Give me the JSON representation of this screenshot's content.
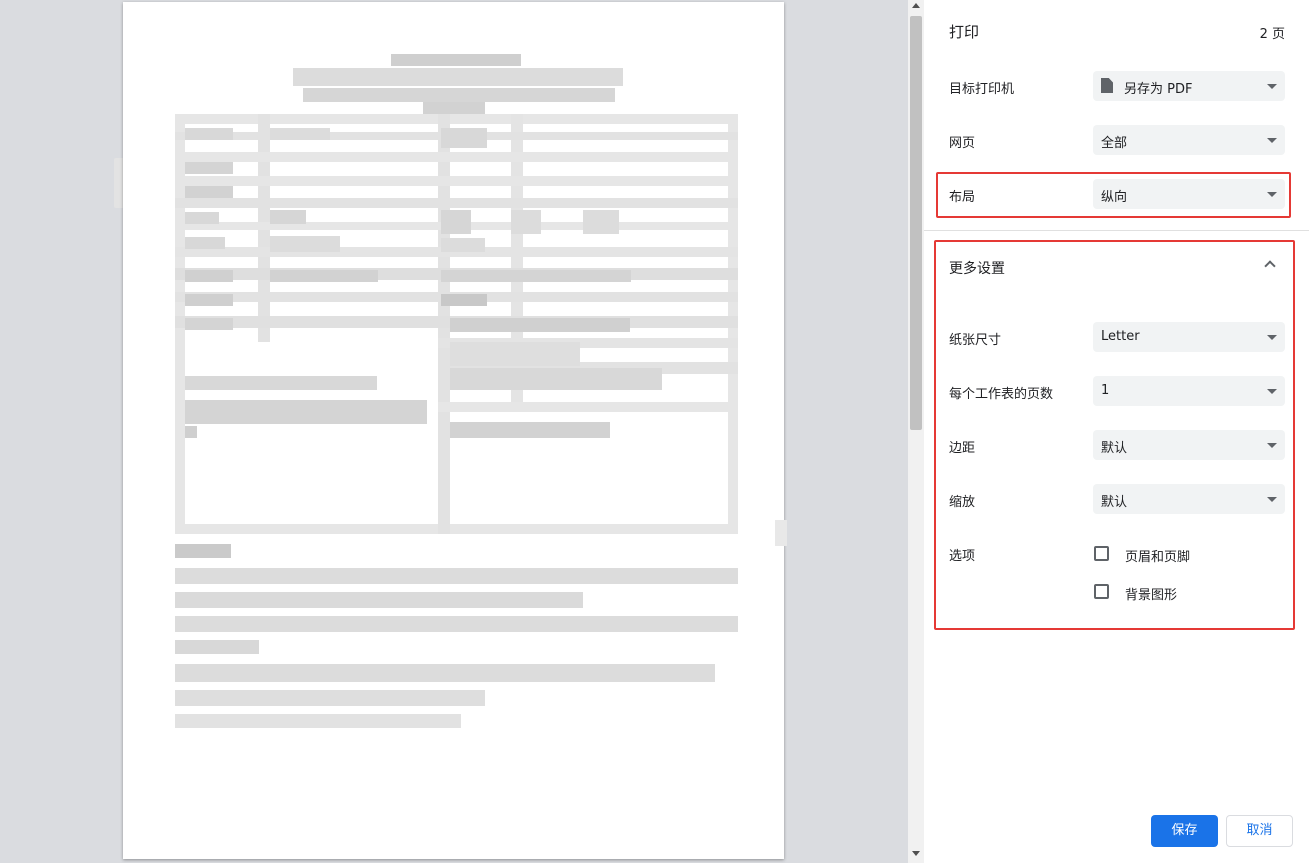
{
  "header": {
    "title": "打印",
    "page_count": "2 页"
  },
  "settings": {
    "destination": {
      "label": "目标打印机",
      "value": "另存为 PDF",
      "icon": "document-icon"
    },
    "pages": {
      "label": "网页",
      "value": "全部"
    },
    "layout": {
      "label": "布局",
      "value": "纵向"
    }
  },
  "more_settings": {
    "label": "更多设置",
    "paper_size": {
      "label": "纸张尺寸",
      "value": "Letter"
    },
    "pages_per_sheet": {
      "label": "每个工作表的页数",
      "value": "1"
    },
    "margins": {
      "label": "边距",
      "value": "默认"
    },
    "scale": {
      "label": "缩放",
      "value": "默认"
    },
    "options": {
      "label": "选项",
      "headers_footers": {
        "label": "页眉和页脚",
        "checked": false
      },
      "background_graphics": {
        "label": "背景图形",
        "checked": false
      }
    }
  },
  "buttons": {
    "save": "保存",
    "cancel": "取消"
  },
  "colors": {
    "accent": "#1a73e8",
    "highlight": "#e53935"
  }
}
